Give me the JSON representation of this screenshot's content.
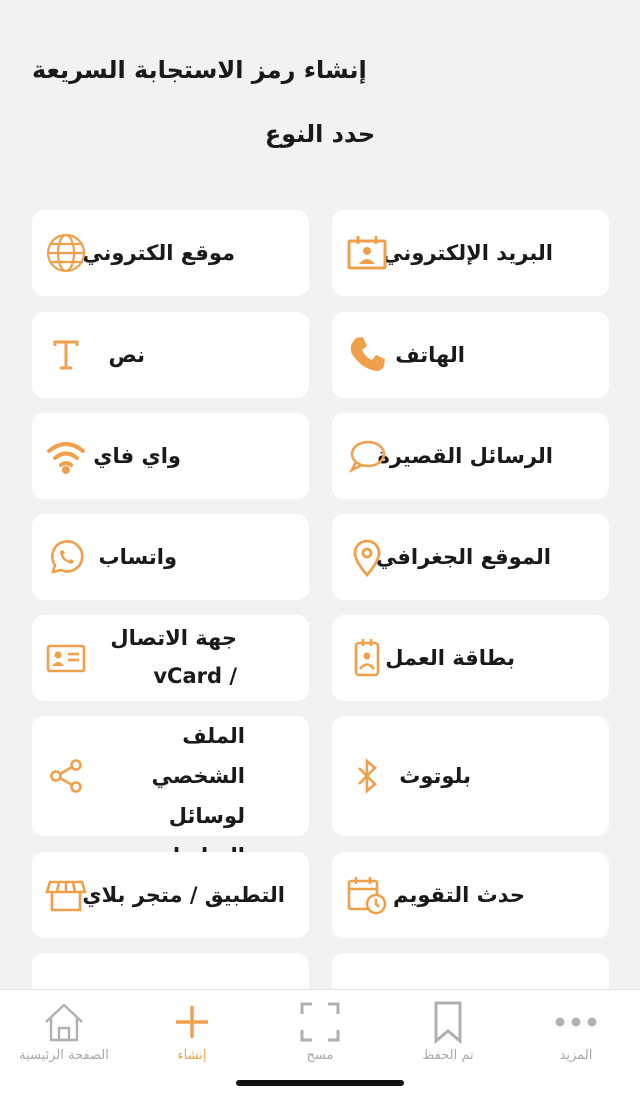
{
  "header": {
    "title": "إنشاء رمز الاستجابة السريعة"
  },
  "section": {
    "title": "حدد النوع"
  },
  "accent": "#f0a04b",
  "types": [
    {
      "label": "البريد الإلكتروني",
      "icon": "email-card-icon"
    },
    {
      "label": "موقع الكتروني",
      "icon": "globe-icon"
    },
    {
      "label": "الهاتف",
      "icon": "phone-icon"
    },
    {
      "label": "نص",
      "icon": "text-icon"
    },
    {
      "label": "الرسائل القصيرة",
      "icon": "chat-bubble-icon"
    },
    {
      "label": "واي فاي",
      "icon": "wifi-icon"
    },
    {
      "label": "الموقع الجغرافي",
      "icon": "location-pin-icon"
    },
    {
      "label": "واتساب",
      "icon": "whatsapp-icon"
    },
    {
      "label": "بطاقة العمل",
      "icon": "badge-icon"
    },
    {
      "label": "جهة الاتصال / vCard",
      "icon": "contact-card-icon"
    },
    {
      "label": "بلوتوث",
      "icon": "bluetooth-icon"
    },
    {
      "label": "الملف الشخصي لوسائل التواصل الاجتماعي",
      "icon": "share-icon"
    },
    {
      "label": "حدث التقويم",
      "icon": "calendar-clock-icon"
    },
    {
      "label": "التطبيق / متجر بلاي",
      "icon": "store-icon"
    }
  ],
  "tabs": [
    {
      "label": "الصفحة الرئيسية",
      "icon": "home-icon",
      "active": false
    },
    {
      "label": "إنشاء",
      "icon": "plus-icon",
      "active": true
    },
    {
      "label": "مسح",
      "icon": "scan-icon",
      "active": false
    },
    {
      "label": "تم الحفظ",
      "icon": "bookmark-icon",
      "active": false
    },
    {
      "label": "المزيد",
      "icon": "more-dots-icon",
      "active": false
    }
  ]
}
